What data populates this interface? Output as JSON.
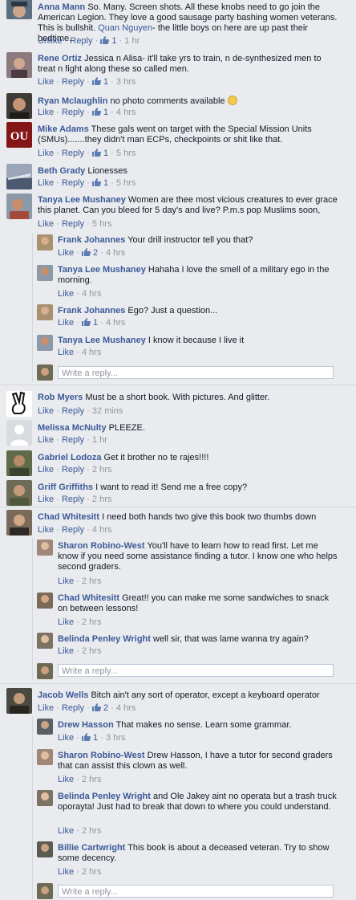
{
  "c01": {
    "name": "Anna Mann",
    "text": "So. Many. Screen shots. All these knobs need to go join the American Legion. They love a good sausage party bashing women veterans. This is bullshit.",
    "mention": "Quan Nguyen",
    "text2": "- the little boys on here are up past their bedtime.",
    "action": "Unlike",
    "reply": "Reply",
    "likes": "1",
    "time": "1 hr"
  },
  "c02": {
    "name": "Rene Ortiz",
    "text": "Jessica n Alisa- it'll take yrs to train, n de-synthesized men to treat n fight along these so called men.",
    "action": "Like",
    "reply": "Reply",
    "likes": "1",
    "time": "3 hrs"
  },
  "c03": {
    "name": "Ryan Mclaughlin",
    "text": "no photo comments available",
    "action": "Like",
    "reply": "Reply",
    "likes": "1",
    "time": "4 hrs"
  },
  "c04": {
    "name": "Mike Adams",
    "text": "These gals went on target with the Special Mission Units (SMUs).......they didn't man ECPs, checkpoints or shit like that.",
    "action": "Like",
    "reply": "Reply",
    "likes": "1",
    "time": "5 hrs"
  },
  "c05": {
    "name": "Beth Grady",
    "text": "Lionesses",
    "action": "Like",
    "reply": "Reply",
    "likes": "1",
    "time": "5 hrs"
  },
  "c06": {
    "name": "Tanya Lee Mushaney",
    "text": "Women are thee most vicious creatures to ever grace this planet. Can you bleed for 5 day's and live? P.m.s pop Muslims soon,",
    "action": "Like",
    "reply": "Reply",
    "time": "5 hrs"
  },
  "r06a": {
    "name": "Frank Johannes",
    "text": "Your drill instructor tell you that?",
    "action": "Like",
    "likes": "2",
    "time": "4 hrs"
  },
  "r06b": {
    "name": "Tanya Lee Mushaney",
    "text": "Hahaha I love the smell of a military ego in the morning.",
    "action": "Like",
    "time": "4 hrs"
  },
  "r06c": {
    "name": "Frank Johannes",
    "text": "Ego? Just a question...",
    "action": "Like",
    "likes": "1",
    "time": "4 hrs"
  },
  "r06d": {
    "name": "Tanya Lee Mushaney",
    "text": "I know it because I live it",
    "action": "Like",
    "time": "4 hrs"
  },
  "reply_placeholder": "Write a reply...",
  "c07": {
    "name": "Rob Myers",
    "text": "Must be a short book. With pictures. And glitter.",
    "action": "Like",
    "reply": "Reply",
    "time": "32 mins"
  },
  "c08": {
    "name": "Melissa McNulty",
    "text": "PLEEZE.",
    "action": "Like",
    "reply": "Reply",
    "time": "1 hr"
  },
  "c09": {
    "name": "Gabriel Lodoza",
    "text": "Get it brother no te rajes!!!!",
    "action": "Like",
    "reply": "Reply",
    "time": "2 hrs"
  },
  "c10": {
    "name": "Griff Griffiths",
    "text": "I want to read it! Send me a free copy?",
    "action": "Like",
    "reply": "Reply",
    "time": "2 hrs"
  },
  "c11": {
    "name": "Chad Whitesitt",
    "text": "I need both hands two give this book two thumbs down",
    "action": "Like",
    "reply": "Reply",
    "time": "4 hrs"
  },
  "r11a": {
    "name": "Sharon Robino-West",
    "text": "You'll have to learn how to read first. Let me know if you need some assistance finding a tutor. I know one who helps second graders.",
    "action": "Like",
    "time": "2 hrs"
  },
  "r11b": {
    "name": "Chad Whitesitt",
    "text": "Great!! you can make me some sandwiches to snack on between lessons!",
    "action": "Like",
    "time": "2 hrs"
  },
  "r11c": {
    "name": "Belinda Penley Wright",
    "text": "well sir, that was lame wanna try again?",
    "action": "Like",
    "time": "2 hrs"
  },
  "c12": {
    "name": "Jacob Wells",
    "text": "Bitch ain't any sort of operator, except a keyboard operator",
    "action": "Like",
    "reply": "Reply",
    "likes": "2",
    "time": "4 hrs"
  },
  "r12a": {
    "name": "Drew Hasson",
    "text": "That makes no sense. Learn some grammar.",
    "action": "Like",
    "likes": "1",
    "time": "3 hrs"
  },
  "r12b": {
    "name": "Sharon Robino-West",
    "text": "Drew Hasson, I have a tutor for second graders that can assist this clown as well.",
    "action": "Like",
    "time": "2 hrs"
  },
  "r12c": {
    "name": "Belinda Penley Wright",
    "text": "and Ole Jakey aint no operata but a trash truck oporayta! Just had to break that down to where you could understand.",
    "action": "Like",
    "time": "2 hrs"
  },
  "r12d": {
    "name": "Billie Cartwright",
    "text": "This book is about a deceased veteran. Try to show some decency.",
    "action": "Like",
    "time": "2 hrs"
  },
  "colors": {
    "link": "#3b5998",
    "meta": "#90949c",
    "bg": "#e9ebee"
  }
}
